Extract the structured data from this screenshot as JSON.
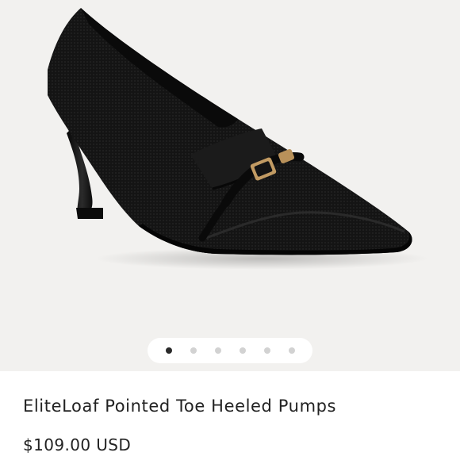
{
  "product": {
    "image_icon": "pointed-toe-heeled-pump-image",
    "title": "EliteLoaf Pointed Toe Heeled Pumps",
    "price": "$109.00 USD"
  },
  "gallery": {
    "slide_count": 6,
    "active_index": 0,
    "background_color": "#f2f1ef",
    "active_dot_color": "#2a2a2a",
    "inactive_dot_color": "#d2d2d2"
  }
}
